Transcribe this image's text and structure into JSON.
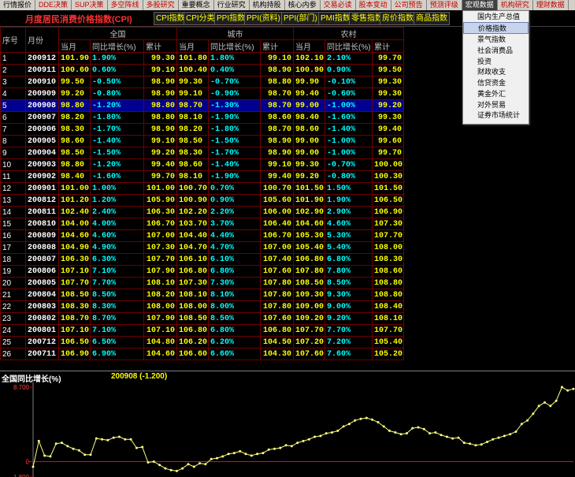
{
  "top_tabs": [
    {
      "label": "行情报价",
      "red": false,
      "active": false
    },
    {
      "label": "DDE决策",
      "red": true,
      "active": false
    },
    {
      "label": "SUP决策",
      "red": true,
      "active": false
    },
    {
      "label": "多空阵线",
      "red": true,
      "active": false
    },
    {
      "label": "多股研究",
      "red": true,
      "active": false
    },
    {
      "label": "重要概念",
      "red": false,
      "active": false
    },
    {
      "label": "行业研究",
      "red": false,
      "active": false
    },
    {
      "label": "机构持股",
      "red": false,
      "active": false
    },
    {
      "label": "核心内参",
      "red": false,
      "active": false
    },
    {
      "label": "交易必读",
      "red": true,
      "active": false
    },
    {
      "label": "股本变动",
      "red": true,
      "active": false
    },
    {
      "label": "公司预告",
      "red": true,
      "active": false
    },
    {
      "label": "预测评级",
      "red": true,
      "active": false
    },
    {
      "label": "宏观数据",
      "red": false,
      "active": true
    },
    {
      "label": "机构研究",
      "red": true,
      "active": false
    },
    {
      "label": "理财数据",
      "red": true,
      "active": false
    }
  ],
  "page_title": "月度居民消费价格指数(CPI)",
  "sub_tabs": [
    "CPI指数",
    "CPI分类",
    "PPI指数",
    "PPI(资料)",
    "PPI(部门)",
    "PMI指数",
    "零售指数",
    "房价指数",
    "商品指数"
  ],
  "dropdown": {
    "selected": 1,
    "items": [
      "国内生产总值",
      "价格指数",
      "景气指数",
      "社会消费品",
      "投资",
      "财政收支",
      "信贷资金",
      "黄金外汇",
      "对外贸易",
      "证券市场统计"
    ]
  },
  "table": {
    "col_index": "序号",
    "col_period": "月份",
    "groups": [
      "全国",
      "城市",
      "农村"
    ],
    "sub_cols": [
      "当月",
      "同比增长(%)",
      "累计"
    ],
    "highlight_row": 4,
    "rows": [
      [
        "1",
        "200912",
        "101.90",
        "1.90%",
        "99.30",
        "101.80",
        "1.80%",
        "99.10",
        "102.10",
        "2.10%",
        "99.70"
      ],
      [
        "2",
        "200911",
        "100.60",
        "0.60%",
        "99.10",
        "100.40",
        "0.40%",
        "98.90",
        "100.90",
        "0.90%",
        "99.50"
      ],
      [
        "3",
        "200910",
        "99.50",
        "-0.50%",
        "98.90",
        "99.30",
        "-0.70%",
        "98.80",
        "99.90",
        "-0.10%",
        "99.30"
      ],
      [
        "4",
        "200909",
        "99.20",
        "-0.80%",
        "98.90",
        "99.10",
        "-0.90%",
        "98.70",
        "99.40",
        "-0.60%",
        "99.30"
      ],
      [
        "5",
        "200908",
        "98.80",
        "-1.20%",
        "98.80",
        "98.70",
        "-1.30%",
        "98.70",
        "99.00",
        "-1.00%",
        "99.20"
      ],
      [
        "6",
        "200907",
        "98.20",
        "-1.80%",
        "98.80",
        "98.10",
        "-1.90%",
        "98.60",
        "98.40",
        "-1.60%",
        "99.30"
      ],
      [
        "7",
        "200906",
        "98.30",
        "-1.70%",
        "98.90",
        "98.20",
        "-1.80%",
        "98.70",
        "98.60",
        "-1.40%",
        "99.40"
      ],
      [
        "8",
        "200905",
        "98.60",
        "-1.40%",
        "99.10",
        "98.50",
        "-1.50%",
        "98.90",
        "99.00",
        "-1.00%",
        "99.60"
      ],
      [
        "9",
        "200904",
        "98.50",
        "-1.50%",
        "99.20",
        "98.30",
        "-1.70%",
        "98.90",
        "99.00",
        "-1.00%",
        "99.70"
      ],
      [
        "10",
        "200903",
        "98.80",
        "-1.20%",
        "99.40",
        "98.60",
        "-1.40%",
        "99.10",
        "99.30",
        "-0.70%",
        "100.00"
      ],
      [
        "11",
        "200902",
        "98.40",
        "-1.60%",
        "99.70",
        "98.10",
        "-1.90%",
        "99.40",
        "99.20",
        "-0.80%",
        "100.30"
      ],
      [
        "12",
        "200901",
        "101.00",
        "1.00%",
        "101.00",
        "100.70",
        "0.70%",
        "100.70",
        "101.50",
        "1.50%",
        "101.50"
      ],
      [
        "13",
        "200812",
        "101.20",
        "1.20%",
        "105.90",
        "100.90",
        "0.90%",
        "105.60",
        "101.90",
        "1.90%",
        "106.50"
      ],
      [
        "14",
        "200811",
        "102.40",
        "2.40%",
        "106.30",
        "102.20",
        "2.20%",
        "106.00",
        "102.90",
        "2.90%",
        "106.90"
      ],
      [
        "15",
        "200810",
        "104.00",
        "4.00%",
        "106.70",
        "103.70",
        "3.70%",
        "106.40",
        "104.60",
        "4.60%",
        "107.30"
      ],
      [
        "16",
        "200809",
        "104.60",
        "4.60%",
        "107.00",
        "104.40",
        "4.40%",
        "106.70",
        "105.30",
        "5.30%",
        "107.70"
      ],
      [
        "17",
        "200808",
        "104.90",
        "4.90%",
        "107.30",
        "104.70",
        "4.70%",
        "107.00",
        "105.40",
        "5.40%",
        "108.00"
      ],
      [
        "18",
        "200807",
        "106.30",
        "6.30%",
        "107.70",
        "106.10",
        "6.10%",
        "107.40",
        "106.80",
        "6.80%",
        "108.30"
      ],
      [
        "19",
        "200806",
        "107.10",
        "7.10%",
        "107.90",
        "106.80",
        "6.80%",
        "107.60",
        "107.80",
        "7.80%",
        "108.60"
      ],
      [
        "20",
        "200805",
        "107.70",
        "7.70%",
        "108.10",
        "107.30",
        "7.30%",
        "107.80",
        "108.50",
        "8.50%",
        "108.80"
      ],
      [
        "21",
        "200804",
        "108.50",
        "8.50%",
        "108.20",
        "108.10",
        "8.10%",
        "107.80",
        "109.30",
        "9.30%",
        "108.80"
      ],
      [
        "22",
        "200803",
        "108.30",
        "8.30%",
        "108.00",
        "108.00",
        "8.00%",
        "107.80",
        "109.00",
        "9.00%",
        "108.40"
      ],
      [
        "23",
        "200802",
        "108.70",
        "8.70%",
        "107.90",
        "108.50",
        "8.50%",
        "107.60",
        "109.20",
        "9.20%",
        "108.10"
      ],
      [
        "24",
        "200801",
        "107.10",
        "7.10%",
        "107.10",
        "106.80",
        "6.80%",
        "106.80",
        "107.70",
        "7.70%",
        "107.70"
      ],
      [
        "25",
        "200712",
        "106.50",
        "6.50%",
        "104.80",
        "106.20",
        "6.20%",
        "104.50",
        "107.20",
        "7.20%",
        "105.40"
      ],
      [
        "26",
        "200711",
        "106.90",
        "6.90%",
        "104.60",
        "106.60",
        "6.60%",
        "104.30",
        "107.60",
        "7.60%",
        "105.20"
      ]
    ]
  },
  "chart": {
    "title": "全国同比增长(%)",
    "cursor_label": "200908 (-1.200)",
    "y_ticks": [
      "8.700",
      "0",
      "-1.800"
    ],
    "ymax": 8.7,
    "ymin": -1.8,
    "values": [
      -0.6,
      2.4,
      0.7,
      0.6,
      2.1,
      2.2,
      1.8,
      1.5,
      1.3,
      0.8,
      0.8,
      2.7,
      2.6,
      2.5,
      2.8,
      2.9,
      2.6,
      2.6,
      1.6,
      1.7,
      -0.1,
      0.0,
      -0.4,
      -0.8,
      -1.0,
      -1.1,
      -0.8,
      -0.3,
      -0.6,
      -0.2,
      -0.3,
      0.3,
      0.4,
      0.6,
      0.9,
      1.0,
      1.2,
      0.9,
      0.7,
      0.9,
      1.0,
      1.4,
      1.5,
      1.6,
      1.9,
      1.8,
      2.2,
      2.4,
      2.6,
      2.9,
      3.0,
      3.3,
      3.4,
      3.6,
      4.1,
      4.4,
      4.8,
      5.0,
      5.1,
      4.9,
      4.6,
      4.1,
      3.6,
      3.4,
      3.2,
      3.3,
      3.9,
      4.0,
      3.8,
      3.3,
      3.4,
      3.1,
      2.9,
      2.7,
      2.8,
      2.2,
      2.1,
      1.9,
      2.0,
      2.3,
      2.6,
      2.8,
      3.0,
      3.2,
      3.5,
      4.4,
      4.8,
      5.6,
      6.5,
      6.9,
      6.5,
      7.1,
      8.7,
      8.3,
      8.5
    ]
  },
  "colors": {
    "line": "#ffff80",
    "zero_line": "#ff0000",
    "grid_border": "#700000",
    "highlight_row_bg": "#000090"
  }
}
